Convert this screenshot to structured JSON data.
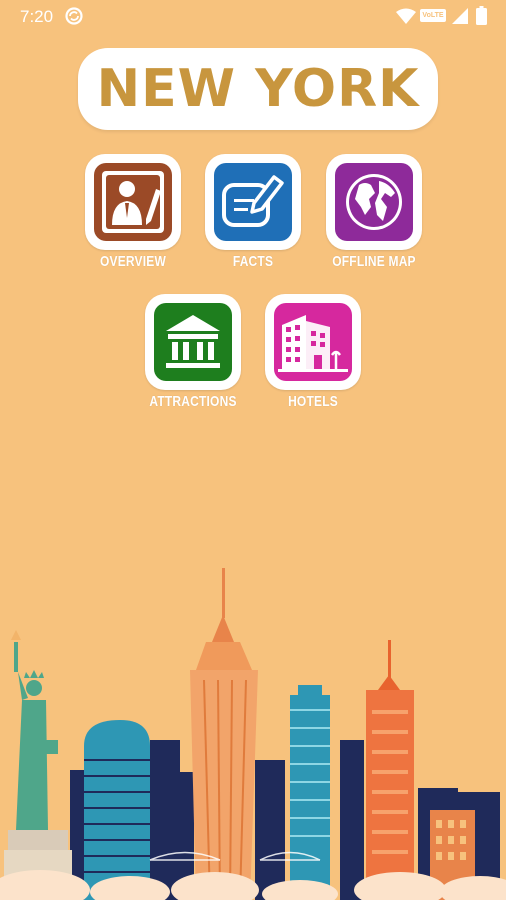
{
  "status_bar": {
    "time": "7:20",
    "icons": [
      "sync-icon",
      "wifi-icon",
      "volte-icon",
      "signal-icon",
      "battery-icon"
    ],
    "volte_label": "VoLTE"
  },
  "app": {
    "title": "NEW YORK"
  },
  "menu": {
    "overview": {
      "label": "OVERVIEW",
      "icon": "businessman-pencil-icon",
      "color": "#9B4A27"
    },
    "facts": {
      "label": "FACTS",
      "icon": "note-edit-icon",
      "color": "#1F6FB7"
    },
    "offline_map": {
      "label": "OFFLINE MAP",
      "icon": "globe-icon",
      "color": "#8E2A9A"
    },
    "attractions": {
      "label": "ATTRACTIONS",
      "icon": "museum-icon",
      "color": "#1E7E1E"
    },
    "hotels": {
      "label": "HOTELS",
      "icon": "hotel-building-icon",
      "color": "#D6289E"
    }
  },
  "colors": {
    "background": "#F7C27D",
    "title_text": "#C8963E"
  }
}
